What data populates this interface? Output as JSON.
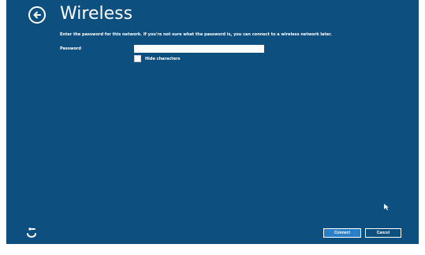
{
  "page": {
    "title": "Wireless",
    "instructions": "Enter the password for this network. If you're not sure what the password is, you can connect to a wireless network later.",
    "password_label": "Password",
    "password_value": "",
    "hide_characters_label": "Hide characters",
    "hide_characters_checked": false
  },
  "icons": {
    "back": "back-arrow-icon",
    "ease_of_access": "ease-of-access-icon",
    "cursor": "mouse-cursor-icon"
  },
  "buttons": {
    "connect_label": "Connect",
    "cancel_label": "Cancel"
  },
  "colors": {
    "background": "#0d4f7f",
    "accent_button": "#2b7fc9",
    "text": "#ffffff"
  }
}
